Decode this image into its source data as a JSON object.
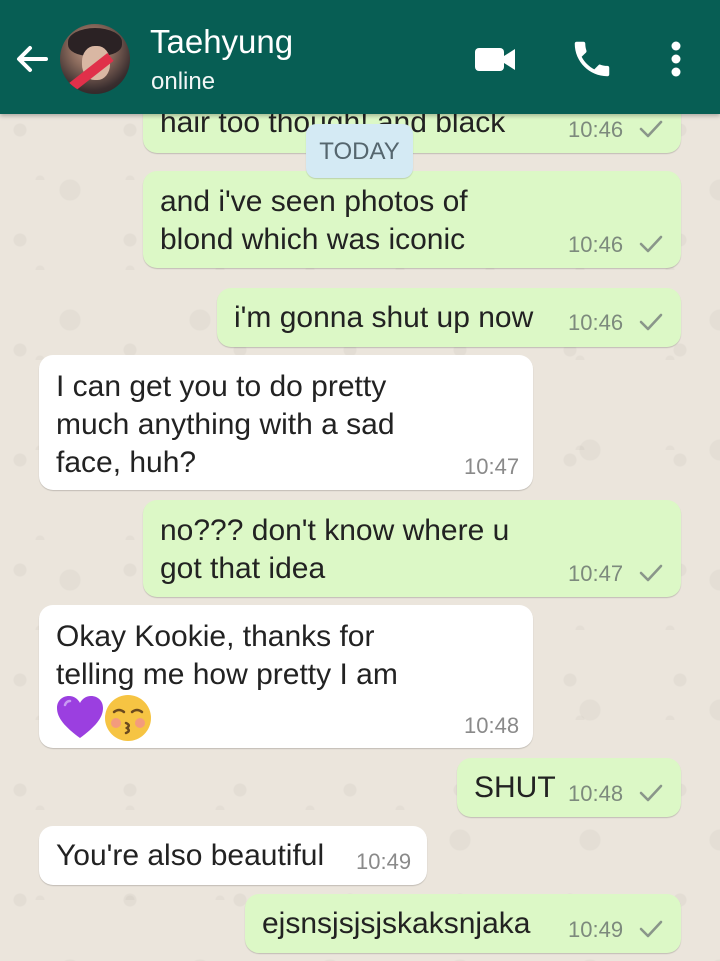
{
  "header": {
    "title": "Taehyung",
    "subtitle": "online",
    "icons": [
      "back-arrow-icon",
      "video-call-icon",
      "phone-icon",
      "more-vert-icon"
    ]
  },
  "date_chip": "TODAY",
  "messages": [
    {
      "direction": "out",
      "text": "hair too though! and black",
      "time": "10:46",
      "status": "sent"
    },
    {
      "direction": "out",
      "text": "and i've seen photos of\nblond which was iconic",
      "time": "10:46",
      "status": "sent"
    },
    {
      "direction": "out",
      "text": "i'm gonna shut up now",
      "time": "10:46",
      "status": "sent"
    },
    {
      "direction": "in",
      "text": "I can get you to do pretty\nmuch anything with a sad\nface, huh?",
      "time": "10:47"
    },
    {
      "direction": "out",
      "text": "no??? don't know where u\ngot that idea",
      "time": "10:47",
      "status": "sent"
    },
    {
      "direction": "in",
      "text": "Okay Kookie, thanks for\ntelling me how pretty I am",
      "emojis": [
        "purple-heart-icon",
        "kissing-face-icon"
      ],
      "time": "10:48"
    },
    {
      "direction": "out",
      "text": "SHUT",
      "time": "10:48",
      "status": "sent"
    },
    {
      "direction": "in",
      "text": "You're also beautiful",
      "time": "10:49"
    },
    {
      "direction": "out",
      "text": "ejsnsjsjsjskaksnjaka",
      "time": "10:49",
      "status": "sent"
    }
  ],
  "colors": {
    "header": "#075e54",
    "outgoing_bubble": "#dcf8c6",
    "incoming_bubble": "#ffffff",
    "date_chip": "#d4eaf4"
  }
}
